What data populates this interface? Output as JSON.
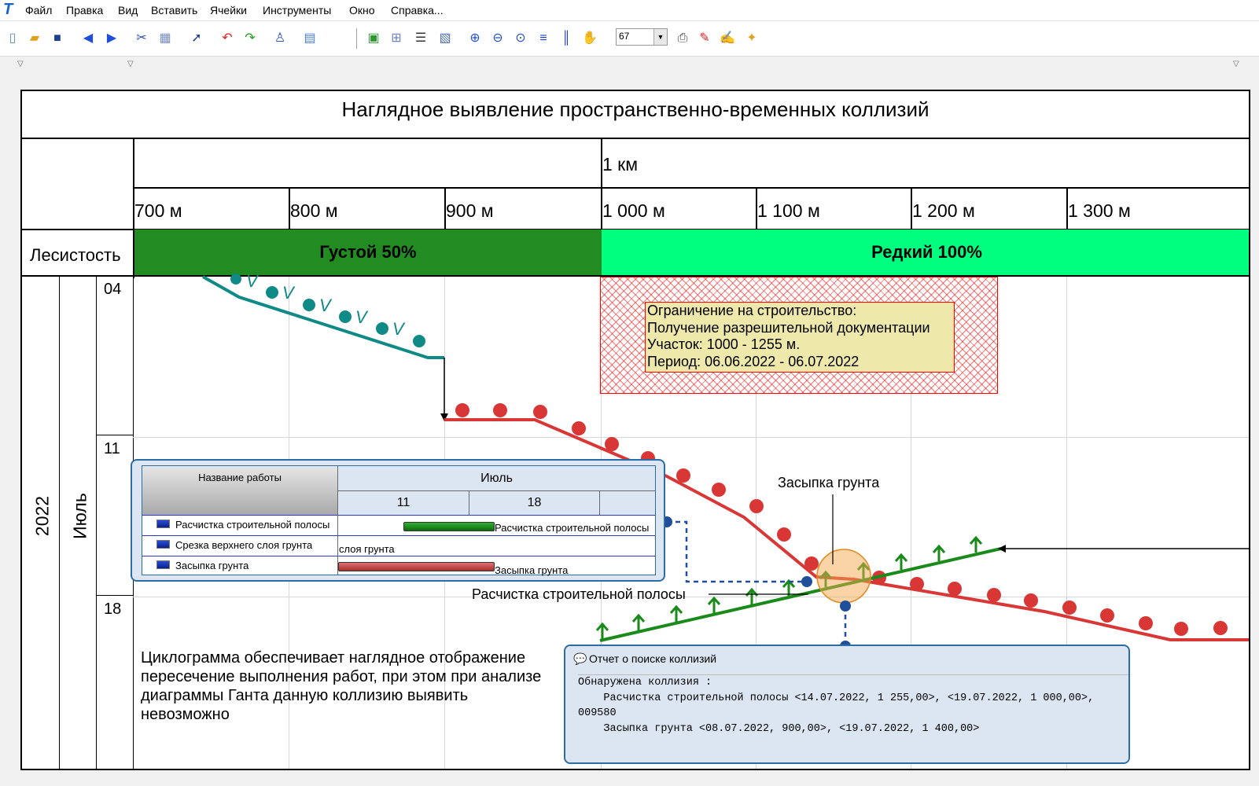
{
  "menu": [
    "Файл",
    "Правка",
    "Вид",
    "Вставить",
    "Ячейки",
    "Инструменты",
    "Окно",
    "Справка..."
  ],
  "toolbar": {
    "zoom_value": "67"
  },
  "chart": {
    "title": "Наглядное выявление пространственно-временных коллизий",
    "km_label": "1 км",
    "distances": [
      "700 м",
      "800 м",
      "900 м",
      "1 000 м",
      "1 100 м",
      "1 200 м",
      "1 300 м"
    ],
    "forest": {
      "label": "Лесистость",
      "dense": "Густой 50%",
      "sparse": "Редкий 100%"
    },
    "year": "2022",
    "month": "Июль",
    "weeks": [
      "04",
      "11",
      "18"
    ],
    "restriction": {
      "line1": "Ограничение на строительство:",
      "line2": "Получение разрешительной документации",
      "line3": "Участок: 1000 - 1255 м.",
      "line4": "Период: 06.06.2022 - 06.07.2022"
    },
    "labels": {
      "backfill": "Засыпка грунта",
      "clearing": "Расчистка строительной полосы"
    },
    "note": "Циклограмма обеспечивает наглядное отображение пересечение выполнения работ, при этом при анализе диаграммы Ганта данную коллизию выявить невозможно"
  },
  "gantt": {
    "header_name": "Название работы",
    "month": "Июль",
    "days": [
      "11",
      "18"
    ],
    "rows": [
      {
        "name": "Расчистка строительной полосы",
        "bar_label": "Расчистка строительной полосы"
      },
      {
        "name": "Срезка верхнего слоя грунта",
        "bar_label": "слоя грунта"
      },
      {
        "name": "Засыпка грунта",
        "bar_label": "Засыпка грунта"
      }
    ]
  },
  "report": {
    "title": "Отчет о поиске коллизий",
    "line1": "Обнаружена коллизия :",
    "line2": "    Расчистка строительной полосы <14.07.2022, 1 255,00>, <19.07.2022, 1 000,00>,",
    "line3": "009580",
    "line4": "    Засыпка грунта <08.07.2022, 900,00>, <19.07.2022, 1 400,00>"
  },
  "colors": {
    "dense": "#228b22",
    "sparse": "#00ff7f",
    "red": "#d93636",
    "green": "#1a8a1a",
    "teal": "#0f8a86",
    "blue": "#2e6da4"
  }
}
